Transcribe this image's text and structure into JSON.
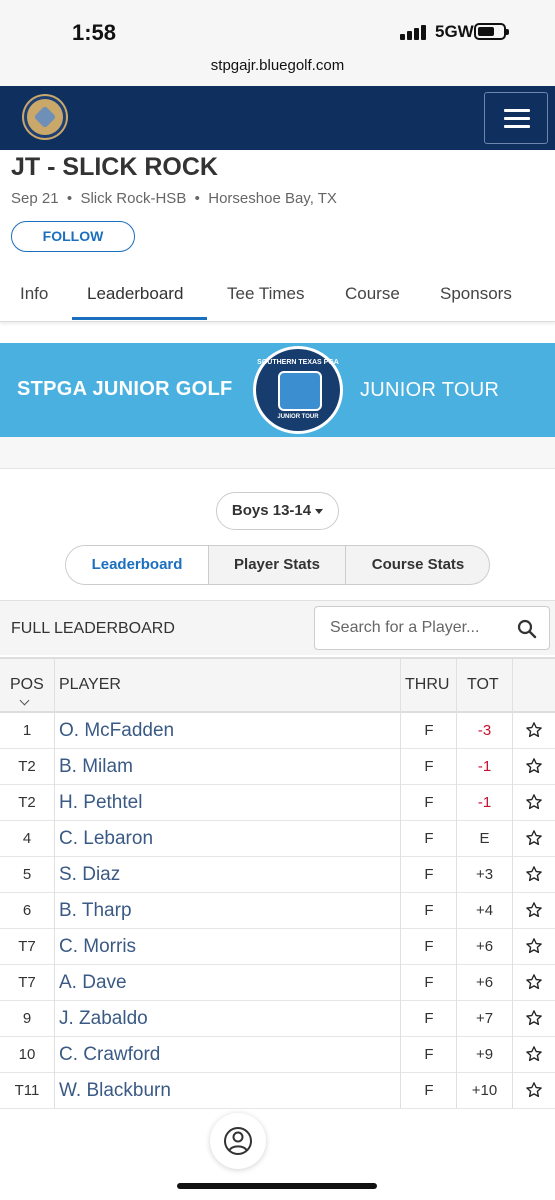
{
  "status_bar": {
    "time": "1:58",
    "network": "5GW"
  },
  "browser": {
    "url": "stpgajr.bluegolf.com"
  },
  "event": {
    "title": "JT - SLICK ROCK",
    "date": "Sep 21",
    "course": "Slick Rock-HSB",
    "location": "Horseshoe Bay, TX",
    "follow_label": "FOLLOW"
  },
  "tabs": [
    "Info",
    "Leaderboard",
    "Tee Times",
    "Course",
    "Sponsors"
  ],
  "banner": {
    "left_text": "STPGA JUNIOR GOLF",
    "right_text": "JUNIOR TOUR",
    "badge_top": "SOUTHERN TEXAS PGA",
    "badge_bottom": "JUNIOR TOUR"
  },
  "division": {
    "selected": "Boys 13-14"
  },
  "segments": [
    "Leaderboard",
    "Player Stats",
    "Course Stats"
  ],
  "leaderboard": {
    "title": "FULL LEADERBOARD",
    "search_placeholder": "Search for a Player...",
    "columns": {
      "pos": "POS",
      "player": "PLAYER",
      "thru": "THRU",
      "tot": "TOT"
    },
    "rows": [
      {
        "pos": "1",
        "player": "O. McFadden",
        "thru": "F",
        "tot": "-3"
      },
      {
        "pos": "T2",
        "player": "B. Milam",
        "thru": "F",
        "tot": "-1"
      },
      {
        "pos": "T2",
        "player": "H. Pethtel",
        "thru": "F",
        "tot": "-1"
      },
      {
        "pos": "4",
        "player": "C. Lebaron",
        "thru": "F",
        "tot": "E"
      },
      {
        "pos": "5",
        "player": "S. Diaz",
        "thru": "F",
        "tot": "+3"
      },
      {
        "pos": "6",
        "player": "B. Tharp",
        "thru": "F",
        "tot": "+4"
      },
      {
        "pos": "T7",
        "player": "C. Morris",
        "thru": "F",
        "tot": "+6"
      },
      {
        "pos": "T7",
        "player": "A. Dave",
        "thru": "F",
        "tot": "+6"
      },
      {
        "pos": "9",
        "player": "J. Zabaldo",
        "thru": "F",
        "tot": "+7"
      },
      {
        "pos": "10",
        "player": "C. Crawford",
        "thru": "F",
        "tot": "+9"
      },
      {
        "pos": "T11",
        "player": "W. Blackburn",
        "thru": "F",
        "tot": "+10"
      }
    ]
  },
  "colors": {
    "header_bg": "#0f2f5e",
    "accent": "#1b6fbf",
    "banner_bg": "#4ab0e0",
    "under_par": "#c8102e",
    "player_link": "#3a5a85"
  },
  "icons": {
    "search": "search-icon",
    "star": "star-outline-icon",
    "profile": "user-circle-icon",
    "menu": "hamburger-icon"
  }
}
